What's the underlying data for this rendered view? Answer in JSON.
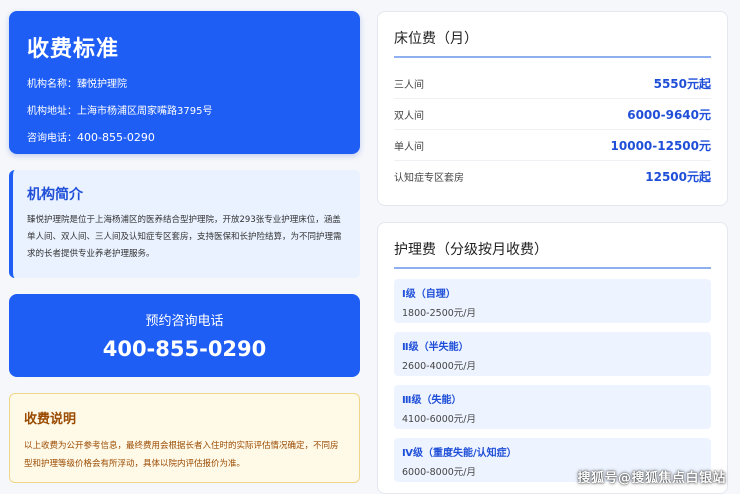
{
  "header": {
    "title": "收费标准",
    "name_line": "机构名称：臻悦护理院",
    "address_line": "机构地址：上海市杨浦区周家嘴路3795号",
    "phone_label": "咨询电话：",
    "phone_number": "400-855-0290"
  },
  "intro": {
    "title": "机构简介",
    "text": "臻悦护理院是位于上海杨浦区的医养结合型护理院，开放293张专业护理床位，涵盖单人间、双人间、三人间及认知症专区套房，支持医保和长护险结算，为不同护理需求的长者提供专业养老护理服务。"
  },
  "call": {
    "label": "预约咨询电话",
    "number": "400-855-0290"
  },
  "note": {
    "title": "收费说明",
    "text": "以上收费为公开参考信息，最终费用会根据长者入住时的实际评估情况确定，不同房型和护理等级价格会有所浮动，具体以院内评估报价为准。"
  },
  "bed_fee": {
    "title": "床位费（月）",
    "rows": [
      {
        "label": "三人间",
        "price": "5550元起"
      },
      {
        "label": "双人间",
        "price": "6000-9640元"
      },
      {
        "label": "单人间",
        "price": "10000-12500元"
      },
      {
        "label": "认知症专区套房",
        "price": "12500元起"
      }
    ]
  },
  "care_fee": {
    "title": "护理费（分级按月收费）",
    "items": [
      {
        "level": "Ⅰ级（自理）",
        "price": "1800-2500元/月"
      },
      {
        "level": "Ⅱ级（半失能）",
        "price": "2600-4000元/月"
      },
      {
        "level": "Ⅲ级（失能）",
        "price": "4100-6000元/月"
      },
      {
        "level": "Ⅳ级（重度失能/认知症）",
        "price": "6000-8000元/月"
      }
    ]
  },
  "watermark": "搜狐号@搜狐焦点白银站"
}
